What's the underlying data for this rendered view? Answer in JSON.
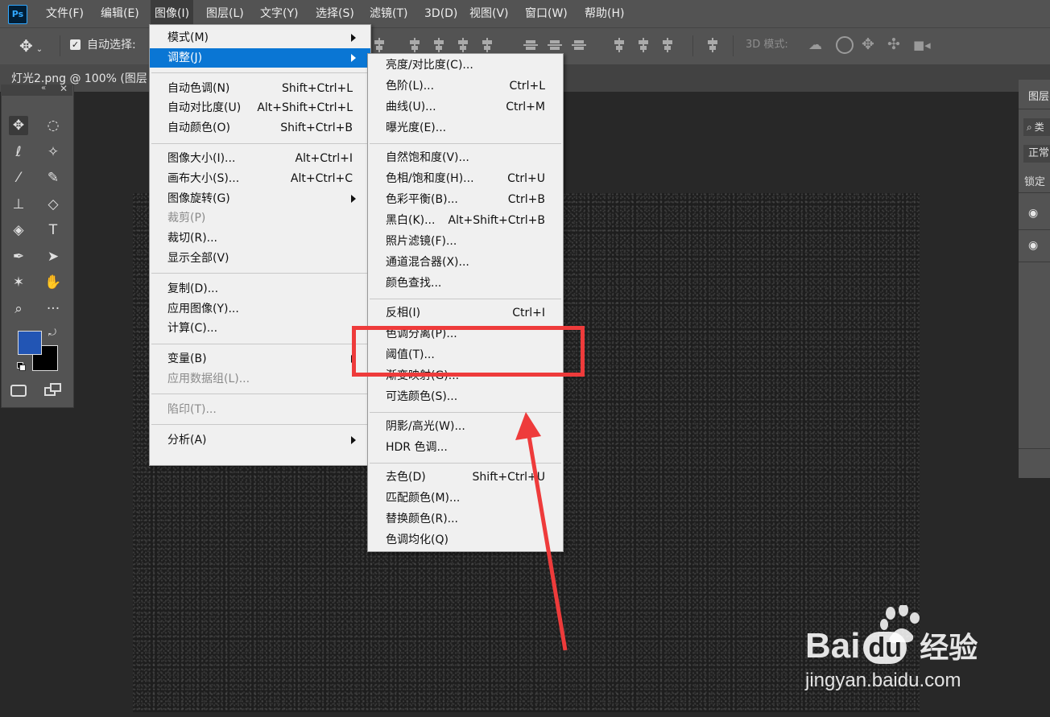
{
  "app": {
    "logo": "Ps"
  },
  "menubar": {
    "items": [
      "文件(F)",
      "编辑(E)",
      "图像(I)",
      "图层(L)",
      "文字(Y)",
      "选择(S)",
      "滤镜(T)",
      "3D(D)",
      "视图(V)",
      "窗口(W)",
      "帮助(H)"
    ],
    "active": "图像(I)"
  },
  "options_bar": {
    "auto_select_label": "自动选择:",
    "auto_select_checked": true,
    "mode_3d_label": "3D 模式:"
  },
  "document": {
    "tab_title": "灯光2.png @ 100% (图层"
  },
  "tools": [
    "move-tool",
    "marquee-tool",
    "lasso-tool",
    "magic-wand-tool",
    "eyedropper-tool",
    "brush-tool",
    "stamp-tool",
    "eraser-tool",
    "paint-bucket-tool",
    "type-tool",
    "pen-tool",
    "path-select-tool",
    "custom-shape-tool",
    "hand-tool",
    "zoom-tool",
    "more-tools"
  ],
  "colors": {
    "foreground": "#2255b4",
    "background": "#000000",
    "highlight": "#0a76d4",
    "annotation": "#ee3b3b"
  },
  "layers_panel": {
    "title": "图层",
    "search": "类",
    "blend_mode": "正常",
    "lock_label": "锁定"
  },
  "image_menu": {
    "groups": [
      [
        {
          "label": "模式(M)",
          "submenu": true
        },
        {
          "label": "调整(J)",
          "submenu": true,
          "highlighted": true
        }
      ],
      [
        {
          "label": "自动色调(N)",
          "shortcut": "Shift+Ctrl+L"
        },
        {
          "label": "自动对比度(U)",
          "shortcut": "Alt+Shift+Ctrl+L"
        },
        {
          "label": "自动颜色(O)",
          "shortcut": "Shift+Ctrl+B"
        }
      ],
      [
        {
          "label": "图像大小(I)...",
          "shortcut": "Alt+Ctrl+I"
        },
        {
          "label": "画布大小(S)...",
          "shortcut": "Alt+Ctrl+C"
        },
        {
          "label": "图像旋转(G)",
          "submenu": true
        },
        {
          "label": "裁剪(P)",
          "disabled": true
        },
        {
          "label": "裁切(R)..."
        },
        {
          "label": "显示全部(V)"
        }
      ],
      [
        {
          "label": "复制(D)..."
        },
        {
          "label": "应用图像(Y)..."
        },
        {
          "label": "计算(C)..."
        }
      ],
      [
        {
          "label": "变量(B)",
          "submenu": true
        },
        {
          "label": "应用数据组(L)...",
          "disabled": true
        }
      ],
      [
        {
          "label": "陷印(T)...",
          "disabled": true
        }
      ],
      [
        {
          "label": "分析(A)",
          "submenu": true
        }
      ]
    ]
  },
  "adjust_menu": {
    "groups": [
      [
        {
          "label": "亮度/对比度(C)..."
        },
        {
          "label": "色阶(L)...",
          "shortcut": "Ctrl+L"
        },
        {
          "label": "曲线(U)...",
          "shortcut": "Ctrl+M"
        },
        {
          "label": "曝光度(E)..."
        }
      ],
      [
        {
          "label": "自然饱和度(V)..."
        },
        {
          "label": "色相/饱和度(H)...",
          "shortcut": "Ctrl+U"
        },
        {
          "label": "色彩平衡(B)...",
          "shortcut": "Ctrl+B"
        },
        {
          "label": "黑白(K)...",
          "shortcut": "Alt+Shift+Ctrl+B"
        },
        {
          "label": "照片滤镜(F)..."
        },
        {
          "label": "通道混合器(X)..."
        },
        {
          "label": "颜色查找..."
        }
      ],
      [
        {
          "label": "反相(I)",
          "shortcut": "Ctrl+I"
        },
        {
          "label": "色调分离(P)..."
        },
        {
          "label": "阈值(T)..."
        },
        {
          "label": "渐变映射(G)..."
        },
        {
          "label": "可选颜色(S)..."
        }
      ],
      [
        {
          "label": "阴影/高光(W)..."
        },
        {
          "label": "HDR 色调..."
        }
      ],
      [
        {
          "label": "去色(D)",
          "shortcut": "Shift+Ctrl+U"
        },
        {
          "label": "匹配颜色(M)..."
        },
        {
          "label": "替换颜色(R)..."
        },
        {
          "label": "色调均化(Q)"
        }
      ]
    ]
  },
  "watermark": {
    "brand": "Bai",
    "brand2": "du",
    "cn": "经验",
    "url": "jingyan.baidu.com"
  }
}
